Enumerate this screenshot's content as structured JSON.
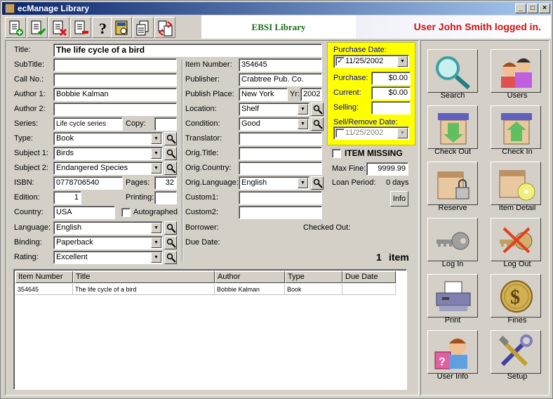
{
  "window": {
    "title": "ecManage Library"
  },
  "header": {
    "library_name": "EBSI Library",
    "user_status": "User John Smith logged in."
  },
  "labels": {
    "title": "Title:",
    "subtitle": "SubTitle:",
    "call_no": "Call No.:",
    "author1": "Author 1:",
    "author2": "Author 2:",
    "series": "Series:",
    "copy": "Copy:",
    "type": "Type:",
    "subject1": "Subject 1:",
    "subject2": "Subject 2:",
    "isbn": "ISBN:",
    "pages": "Pages:",
    "edition": "Edition:",
    "printing": "Printing:",
    "country": "Country:",
    "autographed": "Autographed",
    "language": "Language:",
    "binding": "Binding:",
    "rating": "Rating:",
    "item_number": "Item Number:",
    "publisher": "Publisher:",
    "publish_place": "Publish Place:",
    "yr": "Yr:",
    "location": "Location:",
    "condition": "Condition:",
    "translator": "Translator:",
    "orig_title": "Orig.Title:",
    "orig_country": "Orig.Country:",
    "orig_language": "Orig.Language:",
    "custom1": "Custom1:",
    "custom2": "Custom2:",
    "borrower": "Borrower:",
    "checked_out": "Checked Out:",
    "due_date": "Due Date:",
    "purchase_date": "Purchase Date:",
    "purchase": "Purchase:",
    "current": "Current:",
    "selling": "Selling:",
    "sell_remove_date": "Sell/Remove Date:",
    "item_missing": "ITEM MISSING",
    "max_fine": "Max Fine:",
    "loan_period": "Loan Period:",
    "items_word": "item"
  },
  "fields": {
    "title": "The life cycle of a bird",
    "subtitle": "",
    "call_no": "",
    "author1": "Bobbie Kalman",
    "author2": "",
    "series": "Life cycle series",
    "copy": "",
    "type": "Book",
    "subject1": "Birds",
    "subject2": "Endangered Species",
    "isbn": "0778706540",
    "pages": "32",
    "edition": "1",
    "printing": "",
    "country": "USA",
    "language": "English",
    "binding": "Paperback",
    "rating": "Excellent",
    "item_number": "354645",
    "publisher": "Crabtree Pub. Co.",
    "publish_place": "New York",
    "yr": "2002",
    "location": "Shelf",
    "condition": "Good",
    "translator": "",
    "orig_title": "",
    "orig_country": "",
    "orig_language": "English",
    "custom1": "",
    "custom2": "",
    "purchase_date": "11/25/2002",
    "purchase": "$0.00",
    "current": "$0.00",
    "selling": "",
    "sell_remove_date": "11/25/2002",
    "max_fine": "9999.99",
    "loan_period": "0 days",
    "item_count": "1"
  },
  "buttons": {
    "info": "Info"
  },
  "table": {
    "columns": [
      "Item Number",
      "Title",
      "Author",
      "Type",
      "Due Date"
    ],
    "rows": [
      [
        "354645",
        "The life cycle of a bird",
        "Bobbie Kalman",
        "Book",
        ""
      ]
    ]
  },
  "side_buttons": [
    "Search",
    "Users",
    "Check Out",
    "Check In",
    "Reserve",
    "Item Detail",
    "Log In",
    "Log Out",
    "Print",
    "Fines",
    "User Info",
    "Setup"
  ],
  "colors": {
    "highlight": "#ffff00",
    "user_status": "#d01010",
    "library_name": "#1a6b1a"
  }
}
